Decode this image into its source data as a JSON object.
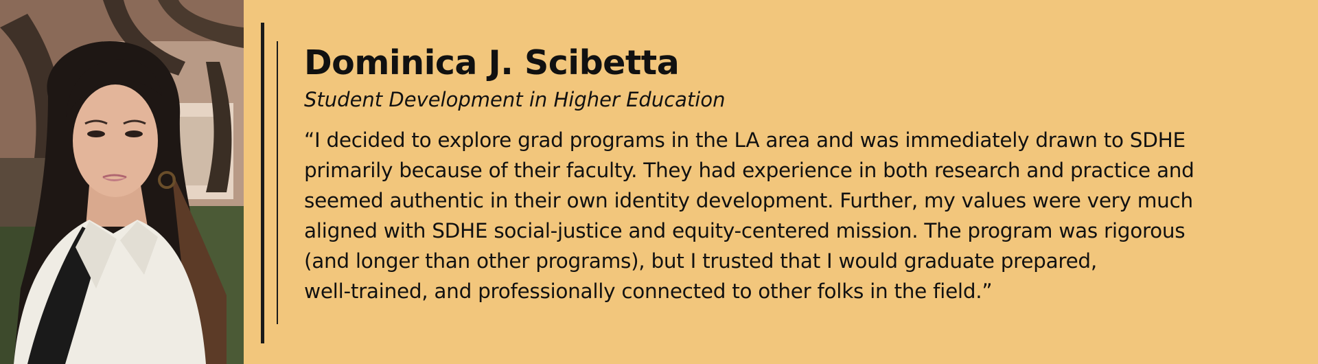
{
  "profile": {
    "name": "Dominica J. Scibetta",
    "program": "Student Development in Higher Education",
    "quote_lines": [
      "“I decided to explore grad programs in the LA area and was immediately drawn to SDHE",
      "primarily because of their faculty. They had experience in both research and practice and",
      "seemed authentic in their own identity development. Further, my values were very much",
      "aligned with SDHE social-justice and equity-centered mission. The program was rigorous",
      "(and longer than other programs), but I trusted that I would graduate prepared,",
      "well-trained, and professionally connected to other folks in the field.”"
    ]
  },
  "colors": {
    "background": "#f2c67c",
    "text": "#111111",
    "rule": "#1a1a1a"
  }
}
